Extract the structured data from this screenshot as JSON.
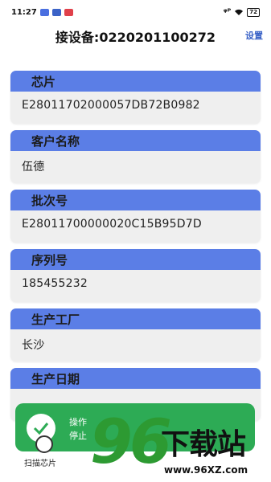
{
  "status_bar": {
    "time": "11:27",
    "signal_text": "ᵠᴾ",
    "battery": "72"
  },
  "header": {
    "title": "接设备:0220201100272",
    "settings_label": "设置"
  },
  "fields": [
    {
      "label": "芯片",
      "value": "E28011702000057DB72B0982"
    },
    {
      "label": "客户名称",
      "value": "伍德"
    },
    {
      "label": "批次号",
      "value": "E28011700000020C15B95D7D"
    },
    {
      "label": "序列号",
      "value": "185455232"
    },
    {
      "label": "生产工厂",
      "value": "长沙"
    },
    {
      "label": "生产日期",
      "value": ""
    }
  ],
  "toast": {
    "line1": "操作",
    "line2": "停止"
  },
  "scan": {
    "label": "扫描芯片"
  },
  "watermark": {
    "digits": "96",
    "text": "下载站",
    "url": "www.96XZ.com"
  },
  "colors": {
    "card_header": "#5b7ee6",
    "card_body": "#efefef",
    "toast": "#2dab55",
    "settings": "#3b63c7",
    "watermark_green": "#2d9a32"
  }
}
